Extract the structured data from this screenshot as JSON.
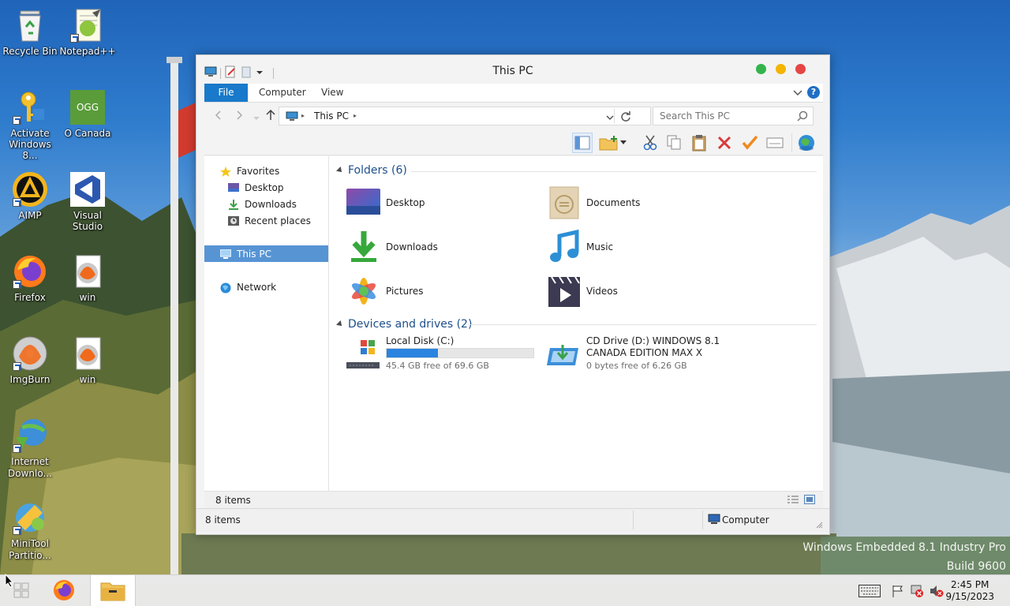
{
  "desktop": {
    "icons": [
      {
        "label": "Recycle Bin",
        "icon": "recycle-bin-icon"
      },
      {
        "label": "Notepad++",
        "icon": "notepad-plus-plus-icon"
      },
      {
        "label": "Activate Windows 8...",
        "icon": "key-icon"
      },
      {
        "label": "O Canada",
        "icon": "ogg-file-icon",
        "badge": "OGG"
      },
      {
        "label": "AIMP",
        "icon": "aimp-icon"
      },
      {
        "label": "Visual Studio",
        "icon": "visual-studio-icon"
      },
      {
        "label": "Firefox",
        "icon": "firefox-icon"
      },
      {
        "label": "win",
        "icon": "imgburn-file-icon"
      },
      {
        "label": "ImgBurn",
        "icon": "imgburn-icon"
      },
      {
        "label": "win",
        "icon": "imgburn-file-icon"
      },
      {
        "label": "Internet Downlo...",
        "icon": "internet-download-manager-icon"
      },
      {
        "label": "MiniTool Partitio...",
        "icon": "minitool-partition-icon"
      }
    ],
    "watermark_line1": "Windows Embedded 8.1 Industry Pro",
    "watermark_line2": "Build 9600"
  },
  "taskbar": {
    "buttons": [
      {
        "name": "start-button",
        "icon": "windows-logo-icon"
      },
      {
        "name": "firefox-taskbar-button",
        "icon": "firefox-icon"
      },
      {
        "name": "file-explorer-taskbar-button",
        "icon": "folder-icon",
        "active": true
      }
    ],
    "tray_icons": [
      "keyboard-icon",
      "flag-icon",
      "network-error-icon",
      "speaker-muted-icon"
    ],
    "time": "2:45 PM",
    "date": "9/15/2023"
  },
  "window": {
    "title": "This PC",
    "ribbon_tabs": [
      "File",
      "Computer",
      "View"
    ],
    "address": {
      "location": "This PC"
    },
    "search": {
      "placeholder": "Search This PC"
    },
    "nav": {
      "favorites_label": "Favorites",
      "favorites": [
        "Desktop",
        "Downloads",
        "Recent places"
      ],
      "this_pc": "This PC",
      "network": "Network"
    },
    "groups": {
      "folders_title": "Folders (6)",
      "drives_title": "Devices and drives (2)"
    },
    "folders": [
      {
        "label": "Desktop",
        "icon": "desktop-folder-icon"
      },
      {
        "label": "Documents",
        "icon": "documents-folder-icon"
      },
      {
        "label": "Downloads",
        "icon": "downloads-folder-icon"
      },
      {
        "label": "Music",
        "icon": "music-folder-icon"
      },
      {
        "label": "Pictures",
        "icon": "pictures-folder-icon"
      },
      {
        "label": "Videos",
        "icon": "videos-folder-icon"
      }
    ],
    "drives": [
      {
        "label": "Local Disk (C:)",
        "free": "45.4 GB free of 69.6 GB",
        "used_fraction": 0.35,
        "icon": "local-disk-icon"
      },
      {
        "label_line1": "CD Drive (D:) WINDOWS 8.1",
        "label_line2": "CANADA EDITION MAX X",
        "free": "0 bytes free of 6.26 GB",
        "icon": "cd-drive-icon"
      }
    ],
    "inner_status": "8 items",
    "status_left": "8 items",
    "status_right": "Computer"
  },
  "colors": {
    "accent": "#1979ca",
    "selection": "#5794d4",
    "progress": "#2b84e0"
  }
}
